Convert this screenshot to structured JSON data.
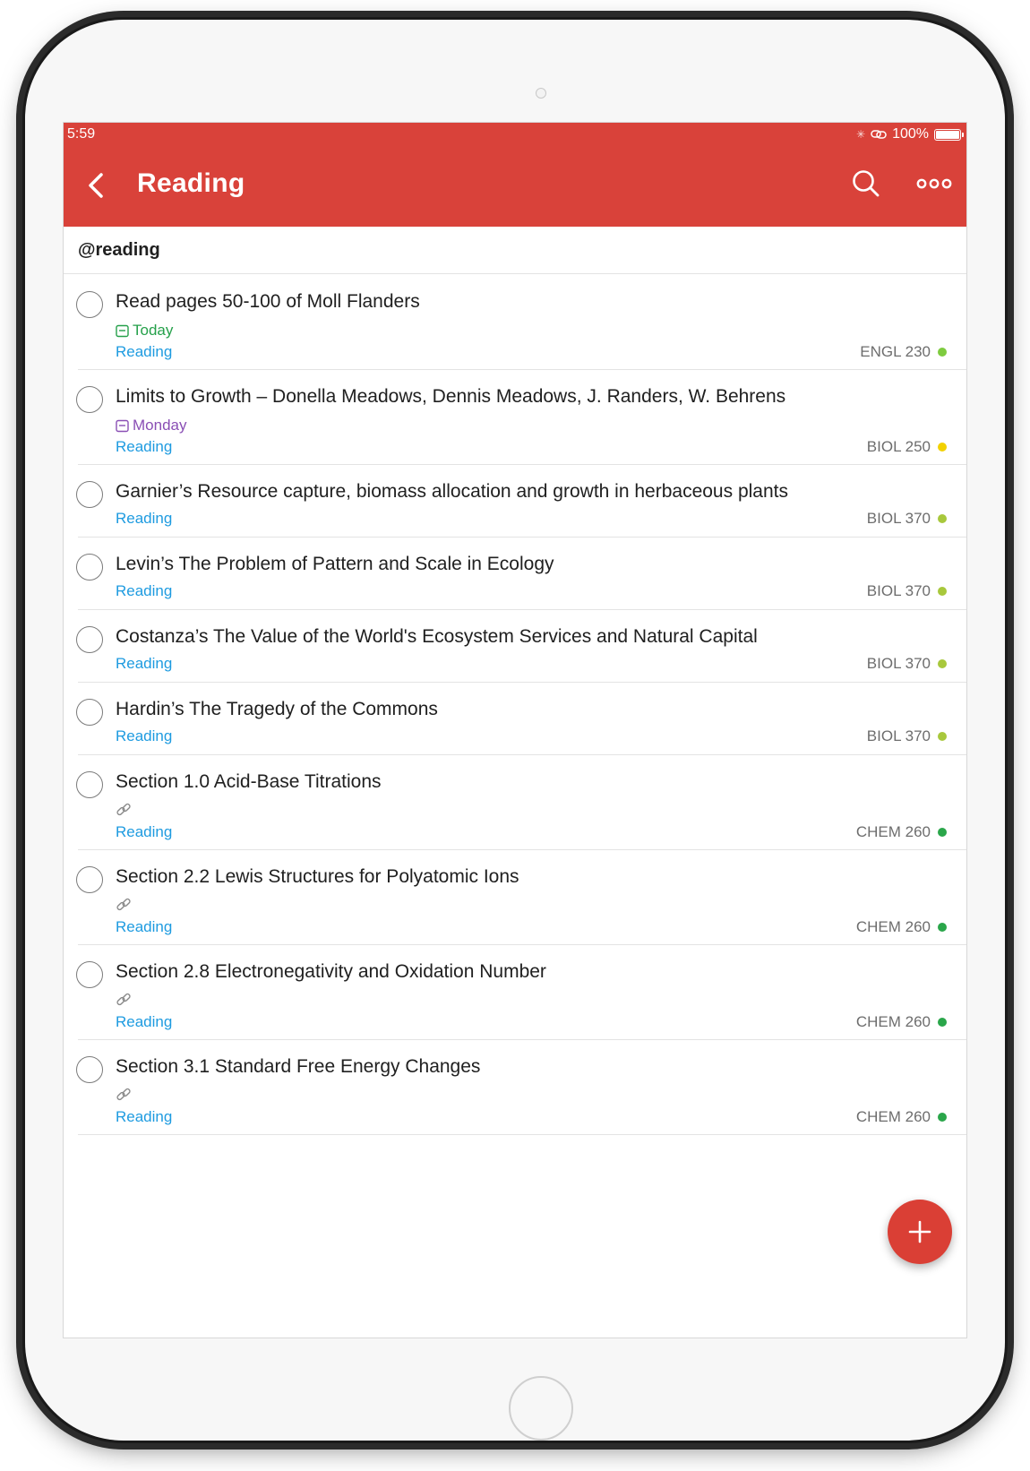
{
  "status_bar": {
    "time": "5:59",
    "battery": "100%",
    "battery_level": 1.0
  },
  "nav": {
    "title": "Reading",
    "back_icon": "chevron-left-icon",
    "search_icon": "search-icon",
    "more_icon": "more-horizontal-icon"
  },
  "filter": {
    "query": "@reading"
  },
  "colors": {
    "accent": "#d9423a",
    "label": "#1e9be0",
    "today": "#25a04a",
    "monday": "#8a4fb5",
    "engl230": "#7ecb3f",
    "biol250": "#f2d100",
    "biol370": "#a8c83c",
    "chem260": "#2aa64a"
  },
  "tasks": [
    {
      "title": "Read pages 50-100 of Moll Flanders",
      "due": "Today",
      "due_color": "#25a04a",
      "label": "Reading",
      "project": "ENGL 230",
      "project_color": "#7ecb3f"
    },
    {
      "title": "Limits to Growth – Donella Meadows, Dennis Meadows, J. Randers, W. Behrens",
      "due": "Monday",
      "due_color": "#8a4fb5",
      "label": "Reading",
      "project": "BIOL 250",
      "project_color": "#f2d100"
    },
    {
      "title": "Garnier’s Resource capture, biomass allocation and growth in herbaceous plants",
      "label": "Reading",
      "project": "BIOL 370",
      "project_color": "#a8c83c"
    },
    {
      "title": "Levin’s The Problem of Pattern and Scale in Ecology",
      "label": "Reading",
      "project": "BIOL 370",
      "project_color": "#a8c83c"
    },
    {
      "title": "Costanza’s The Value of the World's Ecosystem Services and Natural Capital",
      "label": "Reading",
      "project": "BIOL 370",
      "project_color": "#a8c83c"
    },
    {
      "title": "Hardin’s The Tragedy of the Commons",
      "label": "Reading",
      "project": "BIOL 370",
      "project_color": "#a8c83c"
    },
    {
      "title": "Section 1.0 Acid-Base Titrations",
      "has_link": true,
      "label": "Reading",
      "project": "CHEM 260",
      "project_color": "#2aa64a"
    },
    {
      "title": "Section 2.2 Lewis Structures for Polyatomic Ions",
      "has_link": true,
      "label": "Reading",
      "project": "CHEM 260",
      "project_color": "#2aa64a"
    },
    {
      "title": "Section 2.8 Electronegativity and Oxidation Number",
      "has_link": true,
      "label": "Reading",
      "project": "CHEM 260",
      "project_color": "#2aa64a"
    },
    {
      "title": "Section 3.1 Standard Free Energy Changes",
      "has_link": true,
      "label": "Reading",
      "project": "CHEM 260",
      "project_color": "#2aa64a"
    }
  ],
  "fab": {
    "icon": "plus-icon"
  }
}
